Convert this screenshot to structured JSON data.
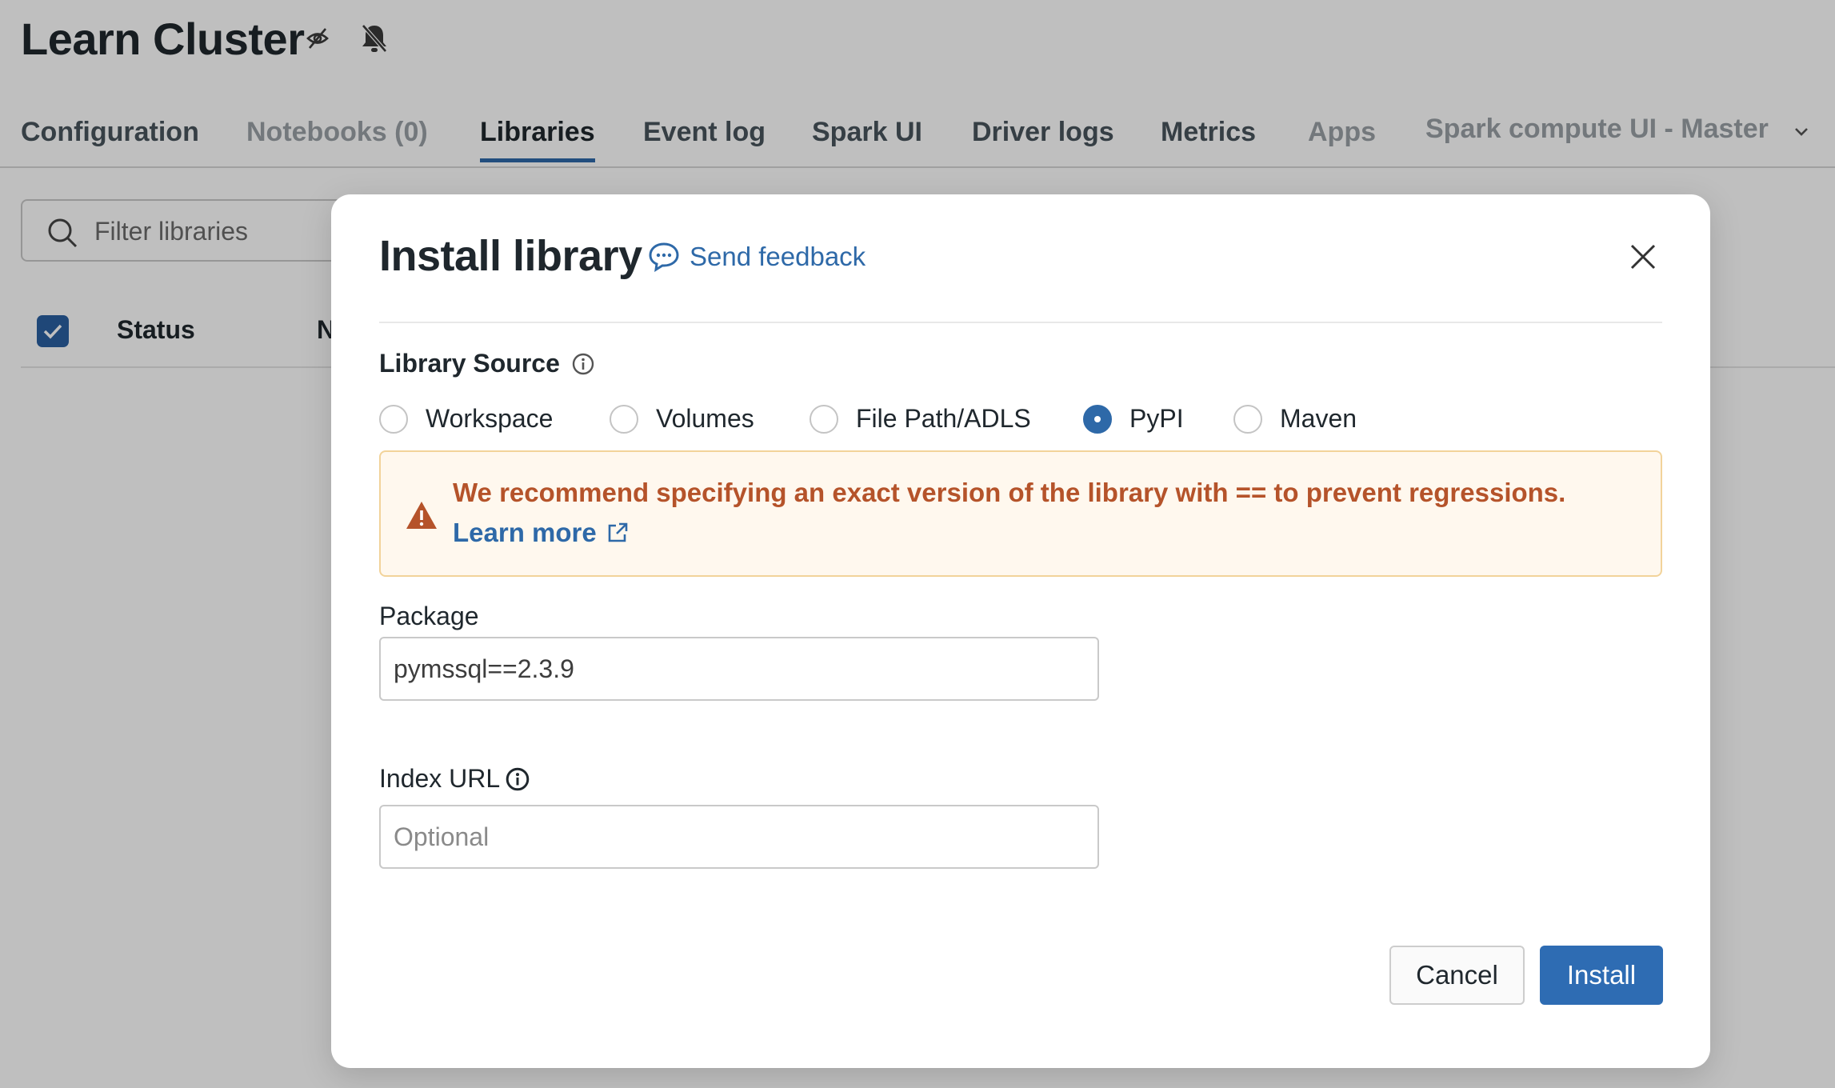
{
  "page": {
    "title": "Learn Cluster",
    "title_icons": [
      "eye-off-icon",
      "bell-off-icon"
    ],
    "tabs": [
      {
        "label": "Configuration",
        "state": "normal"
      },
      {
        "label": "Notebooks (0)",
        "state": "muted"
      },
      {
        "label": "Libraries",
        "state": "active"
      },
      {
        "label": "Event log",
        "state": "normal"
      },
      {
        "label": "Spark UI",
        "state": "normal"
      },
      {
        "label": "Driver logs",
        "state": "normal"
      },
      {
        "label": "Metrics",
        "state": "normal"
      },
      {
        "label": "Apps",
        "state": "muted"
      },
      {
        "label": "Spark compute UI - Master",
        "state": "muted"
      }
    ],
    "filter_placeholder": "Filter libraries",
    "table": {
      "col_status": "Status",
      "col_name_partial": "N"
    }
  },
  "modal": {
    "title": "Install library",
    "feedback_label": "Send feedback",
    "library_source_label": "Library Source",
    "sources": [
      {
        "label": "Workspace",
        "selected": false
      },
      {
        "label": "Volumes",
        "selected": false
      },
      {
        "label": "File Path/ADLS",
        "selected": false
      },
      {
        "label": "PyPI",
        "selected": true
      },
      {
        "label": "Maven",
        "selected": false
      }
    ],
    "alert": {
      "message": "We recommend specifying an exact version of the library with == to prevent regressions.",
      "link": "Learn more"
    },
    "package": {
      "label": "Package",
      "value": "pymssql==2.3.9"
    },
    "index_url": {
      "label": "Index URL",
      "placeholder": "Optional"
    },
    "buttons": {
      "cancel": "Cancel",
      "install": "Install"
    }
  },
  "colors": {
    "accent": "#2e69a8",
    "warning_text": "#b5532a",
    "warning_bg": "#fff8ee",
    "warning_border": "#f2d39a",
    "overlay": "rgba(0,0,0,0.25)"
  }
}
